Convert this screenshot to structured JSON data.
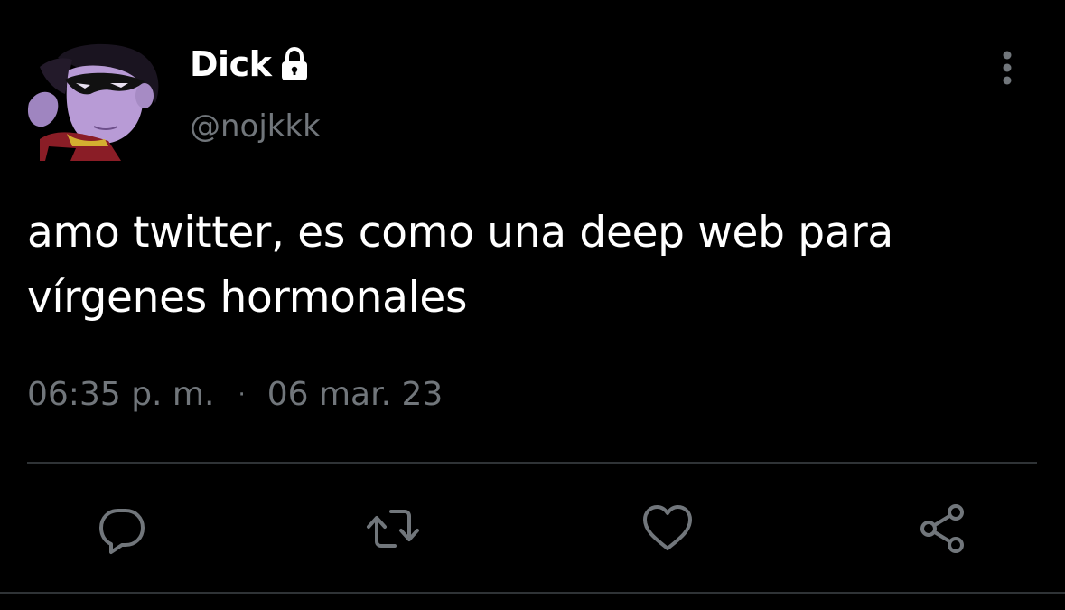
{
  "tweet": {
    "display_name": "Dick",
    "handle": "@nojkkk",
    "text": "amo twitter, es como una deep web para vírgenes hormonales",
    "time": "06:35 p. m.",
    "separator": "·",
    "date": "06 mar. 23"
  },
  "icons": {
    "lock": "lock-icon",
    "more": "more-vertical-icon",
    "reply": "reply-icon",
    "retweet": "retweet-icon",
    "like": "heart-icon",
    "share": "share-icon"
  },
  "colors": {
    "background": "#000000",
    "primary_text": "#ffffff",
    "secondary_text": "#71767b",
    "divider": "#2f3336"
  }
}
